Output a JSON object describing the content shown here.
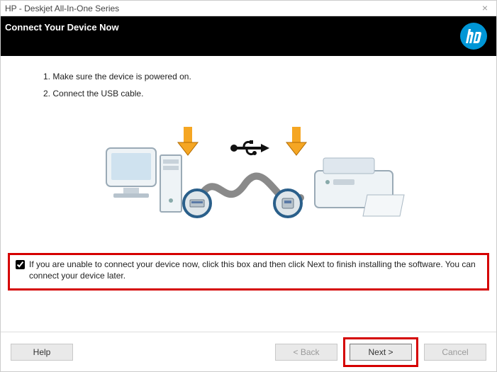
{
  "titlebar": {
    "text": "HP - Deskjet All-In-One Series"
  },
  "header": {
    "title": "Connect Your Device Now",
    "logo_alt": "hp"
  },
  "steps": {
    "s1_num": "1.",
    "s1_text": "Make sure the device is powered on.",
    "s2_num": "2.",
    "s2_text": "Connect the USB cable."
  },
  "skip": {
    "checked": true,
    "label": "If you are unable to connect your device now, click this box and then click Next to finish installing the software. You can connect your device later."
  },
  "footer": {
    "help": "Help",
    "back": "< Back",
    "next": "Next >",
    "cancel": "Cancel"
  }
}
